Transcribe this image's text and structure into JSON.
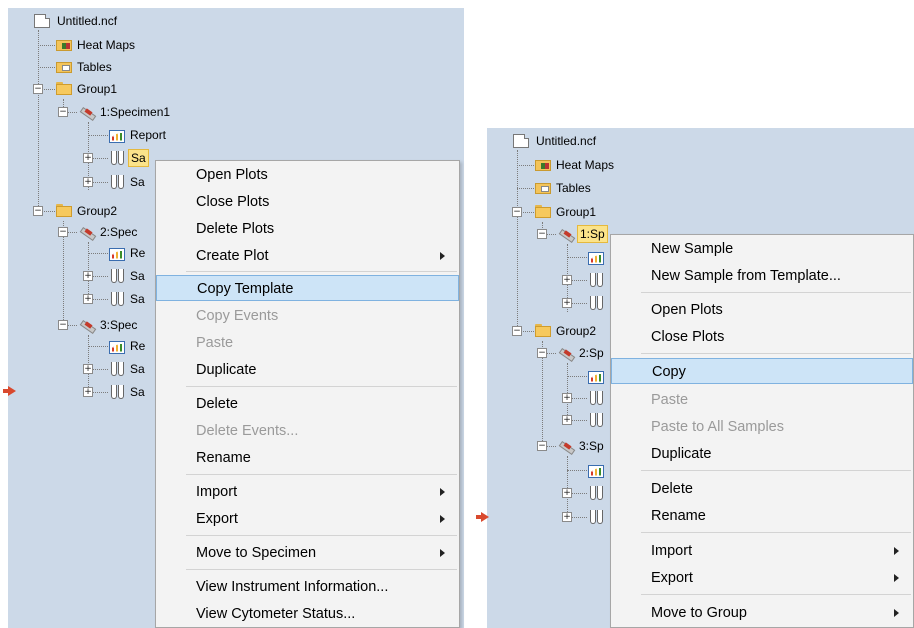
{
  "left": {
    "tree": {
      "root": "Untitled.ncf",
      "heat_maps": "Heat Maps",
      "tables": "Tables",
      "group1": "Group1",
      "specimen1": "1:Specimen1",
      "report1": "Report",
      "sample1_partial": "Sa",
      "sample2_partial": "Sa",
      "group2": "Group2",
      "specimen2_partial": "2:Spec",
      "report2_partial": "Re",
      "sample3_partial": "Sa",
      "sample4_partial": "Sa",
      "specimen3_partial": "3:Spec",
      "report3_partial": "Re",
      "sample5_partial": "Sa",
      "sample6_partial": "Sa"
    },
    "menu": {
      "open_plots": "Open Plots",
      "close_plots": "Close Plots",
      "delete_plots": "Delete Plots",
      "create_plot": "Create Plot",
      "copy_template": "Copy Template",
      "copy_events": "Copy Events",
      "paste": "Paste",
      "duplicate": "Duplicate",
      "delete": "Delete",
      "delete_events": "Delete Events...",
      "rename": "Rename",
      "import": "Import",
      "export": "Export",
      "move_to_specimen": "Move to Specimen",
      "view_instrument_information": "View Instrument Information...",
      "view_cytometer_status": "View Cytometer Status..."
    }
  },
  "right": {
    "tree": {
      "root": "Untitled.ncf",
      "heat_maps": "Heat Maps",
      "tables": "Tables",
      "group1": "Group1",
      "specimen1_partial": "1:Sp",
      "group2": "Group2",
      "specimen2_partial": "2:Sp",
      "specimen3_partial": "3:Sp"
    },
    "menu": {
      "new_sample": "New Sample",
      "new_sample_from_template": "New Sample from Template...",
      "open_plots": "Open Plots",
      "close_plots": "Close Plots",
      "copy": "Copy",
      "paste": "Paste",
      "paste_to_all_samples": "Paste to All Samples",
      "duplicate": "Duplicate",
      "delete": "Delete",
      "rename": "Rename",
      "import": "Import",
      "export": "Export",
      "move_to_group": "Move to Group"
    }
  },
  "colors": {
    "tree_background": "#ccd9e8",
    "menu_background": "#f3f3f3",
    "menu_highlight": "#cde4f7",
    "node_selection": "#fbe38a",
    "arrow": "#d9492e"
  }
}
